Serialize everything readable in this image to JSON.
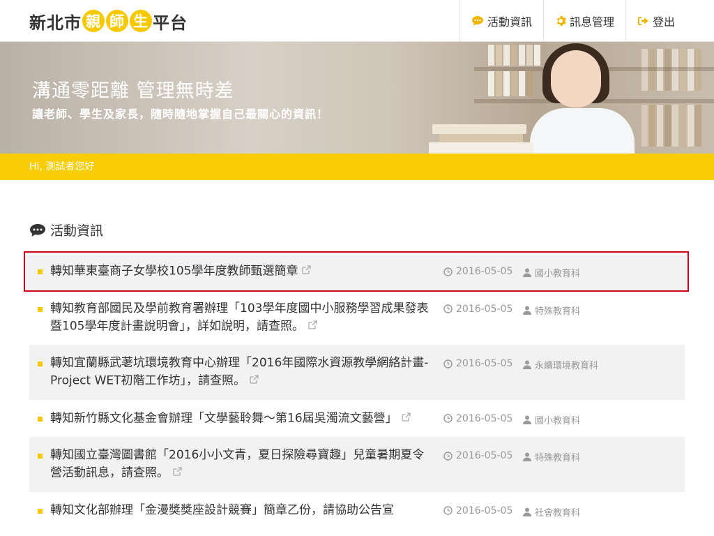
{
  "header": {
    "logo": {
      "prefix": "新北市",
      "c1": "親",
      "c2": "師",
      "c3": "生",
      "suffix": "平台"
    },
    "nav": [
      {
        "label": "活動資訊",
        "icon": "chat-bubble-icon"
      },
      {
        "label": "訊息管理",
        "icon": "gear-icon"
      },
      {
        "label": "登出",
        "icon": "sign-out-icon"
      }
    ]
  },
  "banner": {
    "title": "溝通零距離 管理無時差",
    "subtitle": "讓老師、學生及家長，隨時隨地掌握自己最關心的資訊！"
  },
  "greeting": "Hi, 測試者您好",
  "section": {
    "title": "活動資訊",
    "icon": "comment-icon"
  },
  "items": [
    {
      "title": "轉知華東臺商子女學校105學年度教師甄選簡章",
      "date": "2016-05-05",
      "dept": "國小教育科"
    },
    {
      "title": "轉知教育部國民及學前教育署辦理「103學年度國中小服務學習成果發表暨105學年度計畫說明會」，詳如說明，請查照。",
      "date": "2016-05-05",
      "dept": "特殊教育科"
    },
    {
      "title": "轉知宜蘭縣武荖坑環境教育中心辦理「2016年國際水資源教學網絡計畫-Project WET初階工作坊」，請查照。",
      "date": "2016-05-05",
      "dept": "永續環境教育科"
    },
    {
      "title": "轉知新竹縣文化基金會辦理「文學藝聆舞～第16屆吳濁流文藝營」",
      "date": "2016-05-05",
      "dept": "國小教育科"
    },
    {
      "title": "轉知國立臺灣圖書館「2016小小文青，夏日探險尋寶趣」兒童暑期夏令營活動訊息，請查照。",
      "date": "2016-05-05",
      "dept": "特殊教育科"
    },
    {
      "title": "轉知文化部辦理「金漫獎獎座設計競賽」簡章乙份，請協助公告宣",
      "date": "2016-05-05",
      "dept": "社會教育科"
    }
  ],
  "colors": {
    "accent": "#f9cd05",
    "highlight_border": "#d0021b"
  }
}
